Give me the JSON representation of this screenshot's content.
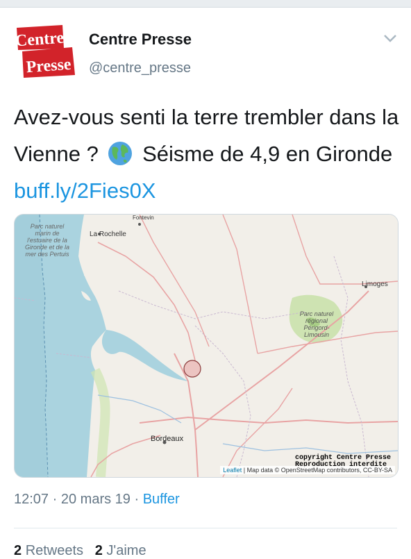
{
  "account": {
    "logo_line1": "Centre",
    "logo_line2": "Presse",
    "name": "Centre Presse",
    "handle": "@centre_presse"
  },
  "tweet": {
    "text_before": "Avez-vous senti la terre trembler dans la Vienne ?",
    "emoji_icon": "globe-icon",
    "text_after": "Séisme de 4,9 en Gironde",
    "link": "buff.ly/2Fies0X"
  },
  "map": {
    "labels": {
      "parc_marin": "Parc naturel marin de l'estuaire de la Gironde et de la mer des Pertuis",
      "la_rochelle": "La Rochelle",
      "fontevin": "Fontevin",
      "limoges": "Limoges",
      "parc_regional": "Parc naturel régional Périgord-Limousin",
      "bordeaux": "Bordeaux"
    },
    "copyright_line1": "copyright Centre Presse",
    "copyright_line2": "Reproduction interdite",
    "attribution_leaflet": "Leaflet",
    "attribution_rest": "| Map data © OpenStreetMap contributors, CC-BY-SA"
  },
  "meta": {
    "time": "12:07",
    "date": "20 mars 19",
    "source": "Buffer"
  },
  "stats": {
    "retweets_count": "2",
    "retweets_label": "Retweets",
    "likes_count": "2",
    "likes_label": "J'aime"
  },
  "colors": {
    "link": "#1b95e0",
    "brand_red": "#d2232a",
    "secondary_text": "#657786"
  }
}
